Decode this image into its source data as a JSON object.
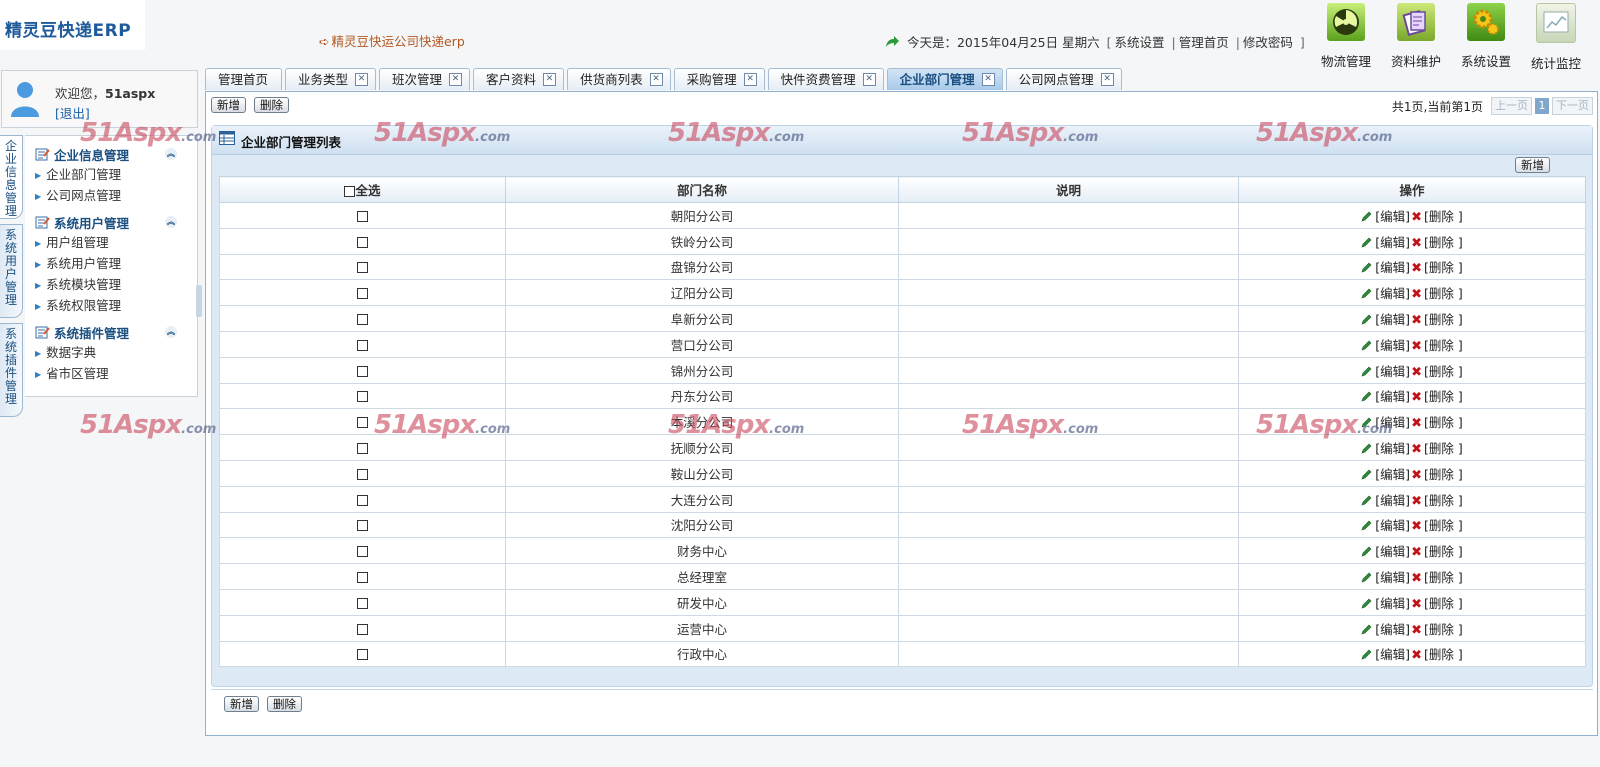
{
  "app": {
    "logo": "精灵豆快递ERP",
    "slogan": "精灵豆快运公司快递erp",
    "date_prefix": "今天是：2015年04月25日  星期六",
    "links": [
      "系统设置",
      "管理首页",
      "修改密码"
    ]
  },
  "topnav": [
    {
      "label": "物流管理",
      "icon": "logistics-icon"
    },
    {
      "label": "资料维护",
      "icon": "data-maintenance-icon"
    },
    {
      "label": "系统设置",
      "icon": "gear-settings-icon"
    },
    {
      "label": "统计监控",
      "icon": "chart-monitor-icon"
    }
  ],
  "user": {
    "welcome": "欢迎您，",
    "name": "51aspx",
    "logout": "[退出]"
  },
  "sidebar": {
    "vtabs": [
      "企业信息管理",
      "系统用户管理",
      "系统插件管理"
    ],
    "groups": [
      {
        "title": "企业信息管理",
        "items": [
          "企业部门管理",
          "公司网点管理"
        ]
      },
      {
        "title": "系统用户管理",
        "items": [
          "用户组管理",
          "系统用户管理",
          "系统模块管理",
          "系统权限管理"
        ]
      },
      {
        "title": "系统插件管理",
        "items": [
          "数据字典",
          "省市区管理"
        ]
      }
    ]
  },
  "tabs": [
    {
      "label": "管理首页",
      "closable": false,
      "active": false
    },
    {
      "label": "业务类型",
      "closable": true,
      "active": false
    },
    {
      "label": "班次管理",
      "closable": true,
      "active": false
    },
    {
      "label": "客户资料",
      "closable": true,
      "active": false
    },
    {
      "label": "供货商列表",
      "closable": true,
      "active": false
    },
    {
      "label": "采购管理",
      "closable": true,
      "active": false
    },
    {
      "label": "快件资费管理",
      "closable": true,
      "active": false
    },
    {
      "label": "企业部门管理",
      "closable": true,
      "active": true
    },
    {
      "label": "公司网点管理",
      "closable": true,
      "active": false
    }
  ],
  "toolbar": {
    "add": "新增",
    "delete": "删除"
  },
  "pager": {
    "info": "共1页,当前第1页",
    "prev": "上一页",
    "current": "1",
    "next": "下一页"
  },
  "panel": {
    "title": "企业部门管理列表",
    "add": "新增"
  },
  "table": {
    "headers": {
      "select_all": "全选",
      "name": "部门名称",
      "desc": "说明",
      "ops": "操作"
    },
    "edit_label": "[编辑]",
    "delete_label": "[删除 ]",
    "rows": [
      {
        "name": "朝阳分公司",
        "desc": ""
      },
      {
        "name": "铁岭分公司",
        "desc": ""
      },
      {
        "name": "盘锦分公司",
        "desc": ""
      },
      {
        "name": "辽阳分公司",
        "desc": ""
      },
      {
        "name": "阜新分公司",
        "desc": ""
      },
      {
        "name": "营口分公司",
        "desc": ""
      },
      {
        "name": "锦州分公司",
        "desc": ""
      },
      {
        "name": "丹东分公司",
        "desc": ""
      },
      {
        "name": "本溪分公司",
        "desc": ""
      },
      {
        "name": "抚顺分公司",
        "desc": ""
      },
      {
        "name": "鞍山分公司",
        "desc": ""
      },
      {
        "name": "大连分公司",
        "desc": ""
      },
      {
        "name": "沈阳分公司",
        "desc": ""
      },
      {
        "name": "财务中心",
        "desc": ""
      },
      {
        "name": "总经理室",
        "desc": ""
      },
      {
        "name": "研发中心",
        "desc": ""
      },
      {
        "name": "运营中心",
        "desc": ""
      },
      {
        "name": "行政中心",
        "desc": ""
      }
    ]
  },
  "watermark": {
    "main": "51Aspx",
    "suffix": ".com"
  },
  "colors": {
    "accent": "#1a4f80",
    "delete_red": "#c0141a",
    "slogan": "#b5581f"
  }
}
